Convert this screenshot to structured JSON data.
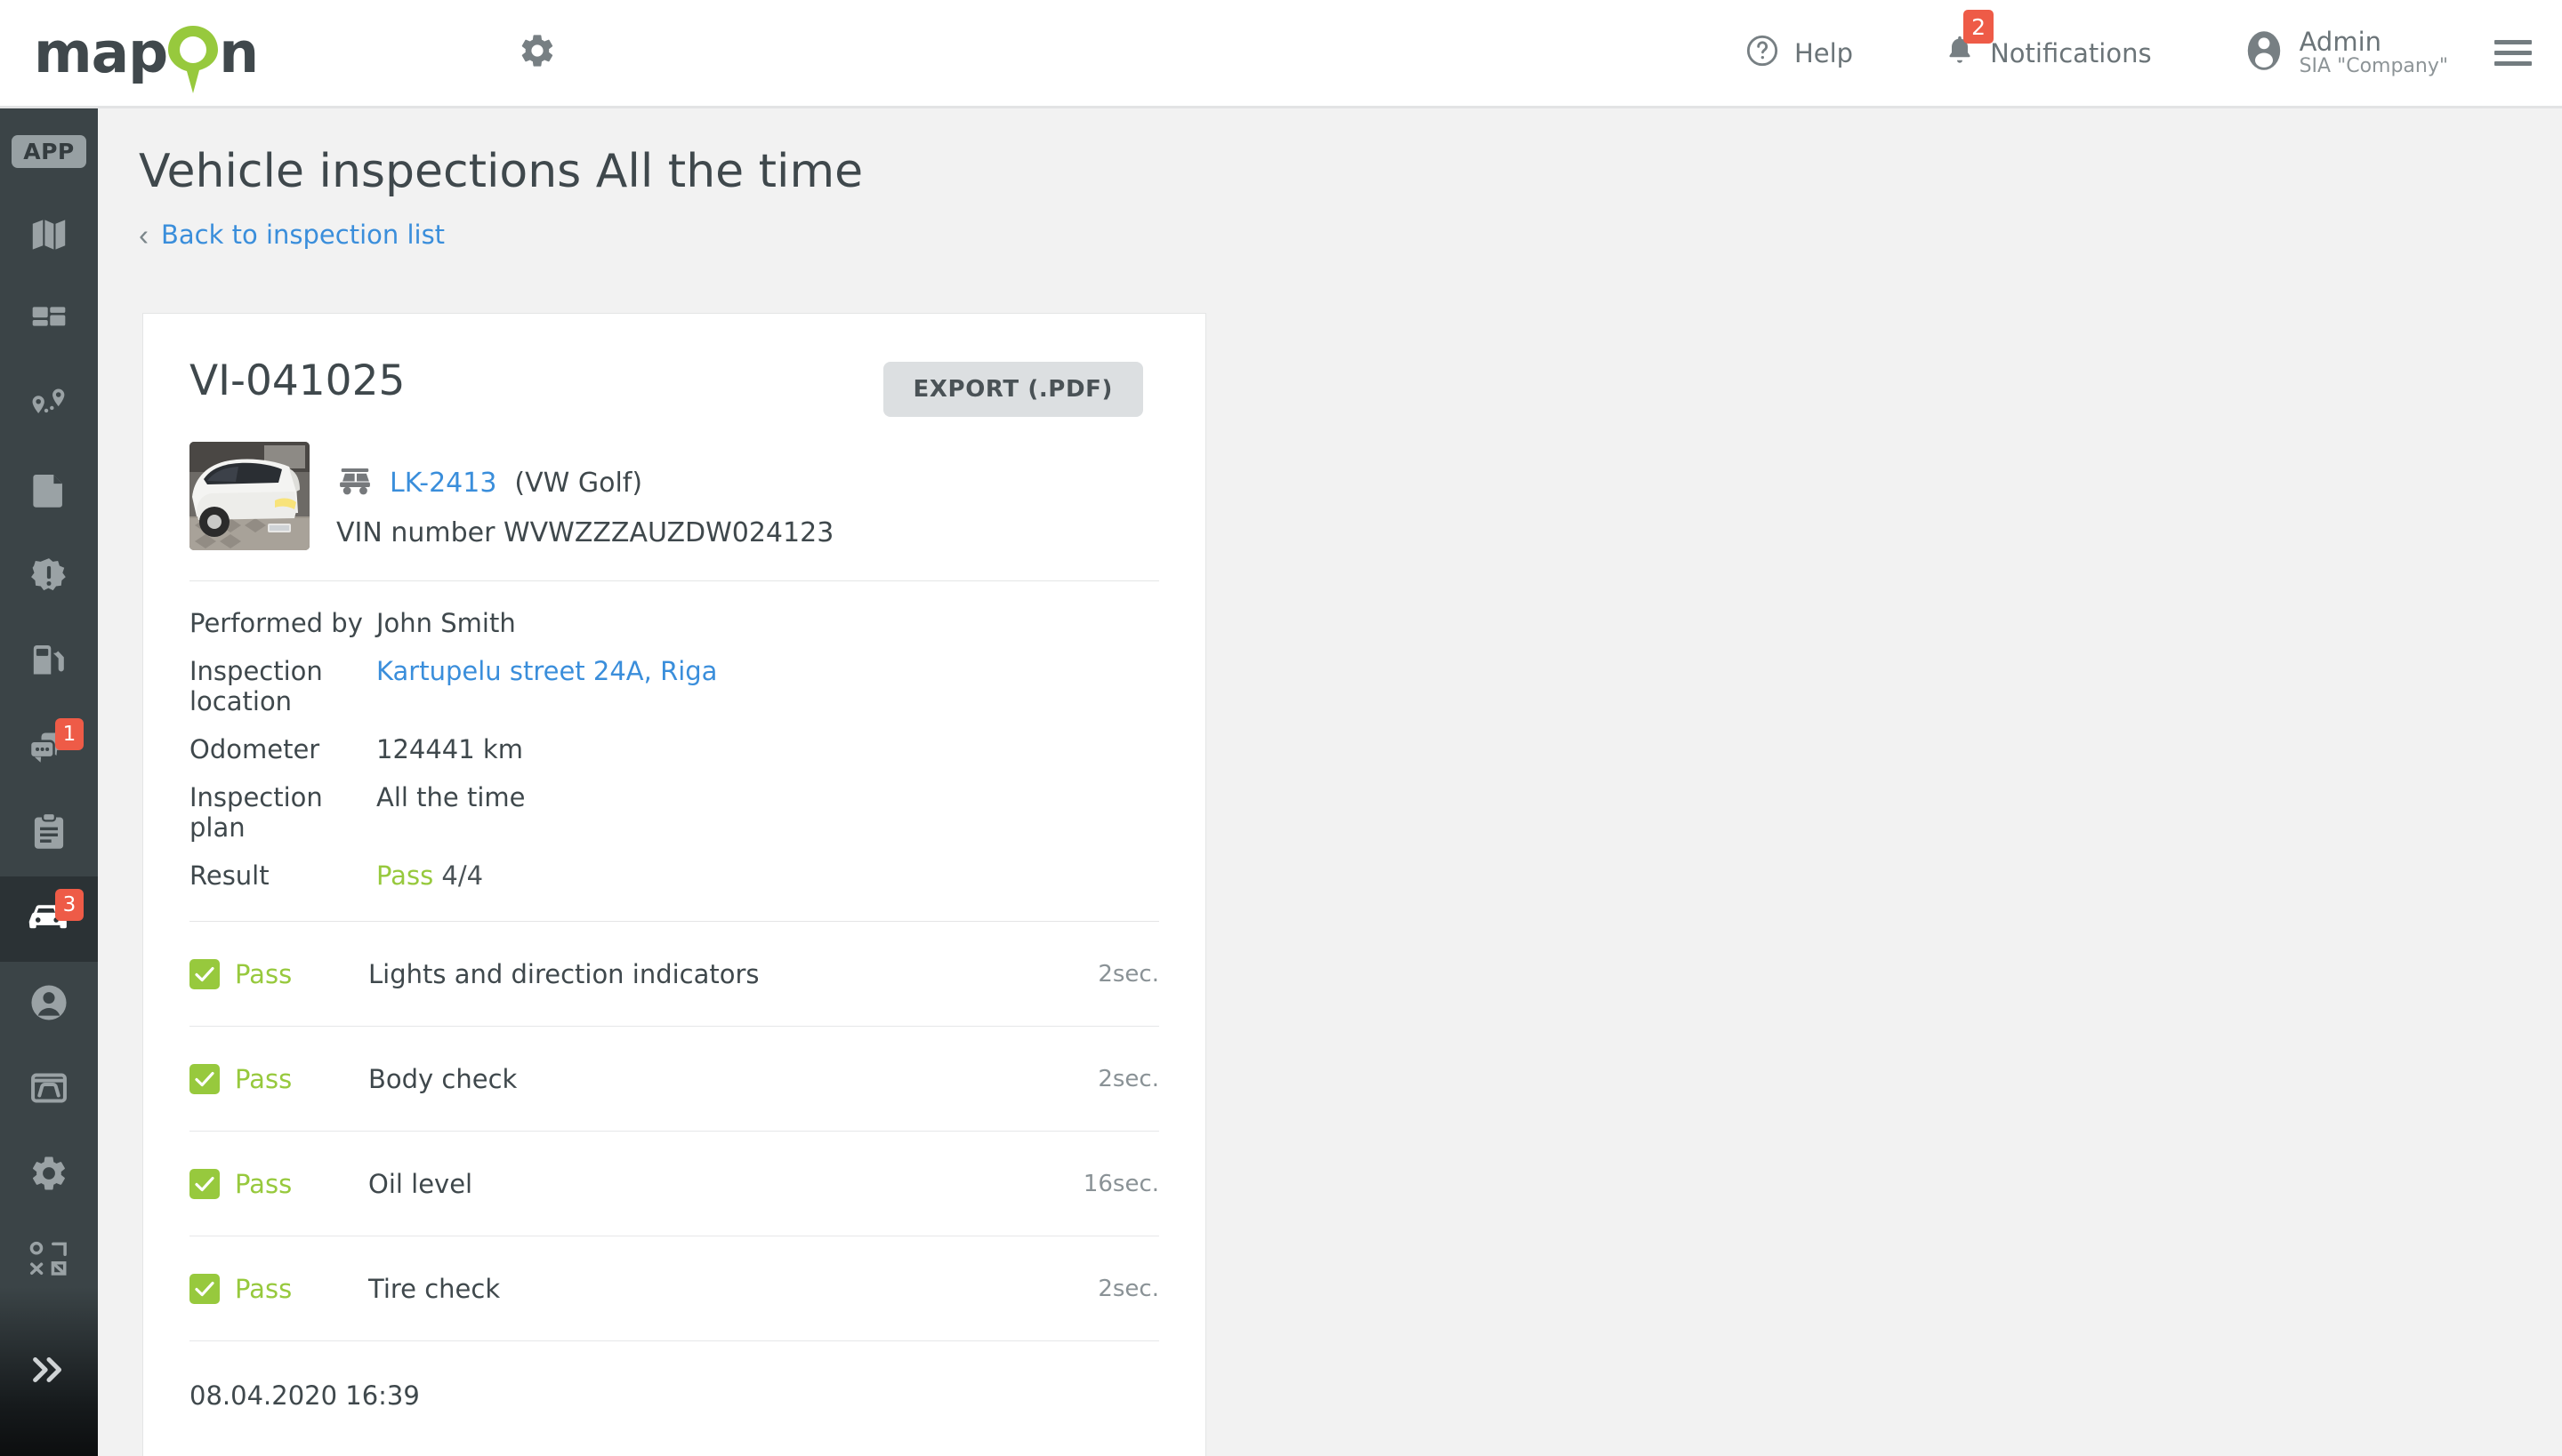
{
  "header": {
    "logo_text_left": "map",
    "logo_text_right": "n",
    "settings_icon": "gear-icon",
    "help_label": "Help",
    "notifications_label": "Notifications",
    "notifications_badge": "2",
    "user_name": "Admin",
    "user_company": "SIA \"Company\"",
    "menu_icon": "hamburger-icon"
  },
  "sidebar": {
    "app_badge": "APP",
    "items": [
      {
        "name": "map-icon",
        "badge": "",
        "active": false
      },
      {
        "name": "dashboard-icon",
        "badge": "",
        "active": false
      },
      {
        "name": "route-pins-icon",
        "badge": "",
        "active": false
      },
      {
        "name": "document-icon",
        "badge": "",
        "active": false
      },
      {
        "name": "alert-icon",
        "badge": "",
        "active": false
      },
      {
        "name": "fuel-pump-icon",
        "badge": "",
        "active": false
      },
      {
        "name": "messages-icon",
        "badge": "1",
        "active": false
      },
      {
        "name": "clipboard-icon",
        "badge": "",
        "active": false
      },
      {
        "name": "vehicles-icon",
        "badge": "3",
        "active": true
      },
      {
        "name": "drivers-icon",
        "badge": "",
        "active": false
      },
      {
        "name": "maintenance-icon",
        "badge": "",
        "active": false
      },
      {
        "name": "settings-icon",
        "badge": "",
        "active": false
      },
      {
        "name": "integrations-icon",
        "badge": "",
        "active": false
      }
    ],
    "expand_icon": "double-chevron-right-icon"
  },
  "page": {
    "title": "Vehicle inspections All the time",
    "back_link": "Back to inspection list"
  },
  "card": {
    "inspection_id": "VI-041025",
    "export_button": "EXPORT (.PDF)",
    "vehicle": {
      "plate": "LK-2413",
      "model": "(VW Golf)",
      "vin_label": "VIN number",
      "vin_value": "WVWZZZAUZDW024123",
      "photo_alt": "white-vw-golf-photo"
    },
    "details": [
      {
        "label": "Performed by",
        "value": "John Smith",
        "type": "text"
      },
      {
        "label": "Inspection location",
        "value": "Kartupelu street 24A, Riga",
        "type": "link"
      },
      {
        "label": "Odometer",
        "value": "124441 km",
        "type": "text"
      },
      {
        "label": "Inspection plan",
        "value": "All the time",
        "type": "text"
      }
    ],
    "result": {
      "label": "Result",
      "status": "Pass",
      "count": "4/4"
    },
    "checks": [
      {
        "status": "Pass",
        "name": "Lights and direction indicators",
        "duration": "2sec."
      },
      {
        "status": "Pass",
        "name": "Body check",
        "duration": "2sec."
      },
      {
        "status": "Pass",
        "name": "Oil level",
        "duration": "16sec."
      },
      {
        "status": "Pass",
        "name": "Tire check",
        "duration": "2sec."
      }
    ],
    "timestamp": "08.04.2020 16:39"
  },
  "colors": {
    "accent_green": "#97c93d",
    "link_blue": "#3a8edb",
    "badge_red": "#ee5b47",
    "sidebar_dark": "#3b4447",
    "text_dark": "#3f484c"
  }
}
